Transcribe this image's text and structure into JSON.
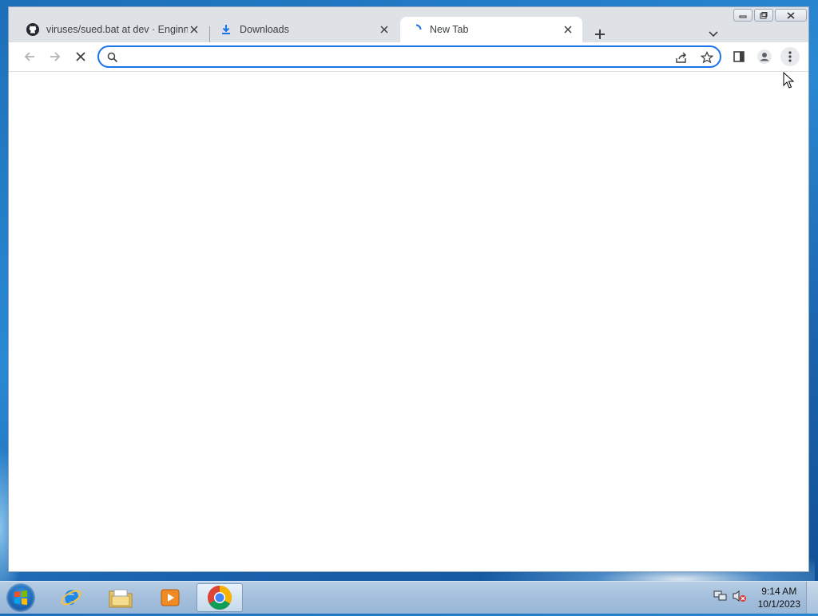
{
  "browser": {
    "tabs": [
      {
        "title": "viruses/sued.bat at dev · Enginne",
        "favicon": "github-icon",
        "active": false
      },
      {
        "title": "Downloads",
        "favicon": "download-icon",
        "active": false
      },
      {
        "title": "New Tab",
        "favicon": "loading-spinner-icon",
        "active": true
      }
    ],
    "omnibox": {
      "value": "",
      "placeholder": ""
    },
    "accent_color": "#1a73e8"
  },
  "taskbar": {
    "apps": [
      {
        "name": "internet-explorer-icon"
      },
      {
        "name": "file-explorer-icon"
      },
      {
        "name": "media-player-icon"
      },
      {
        "name": "chrome-icon",
        "active": true
      }
    ],
    "clock": {
      "time": "9:14 AM",
      "date": "10/1/2023"
    }
  }
}
